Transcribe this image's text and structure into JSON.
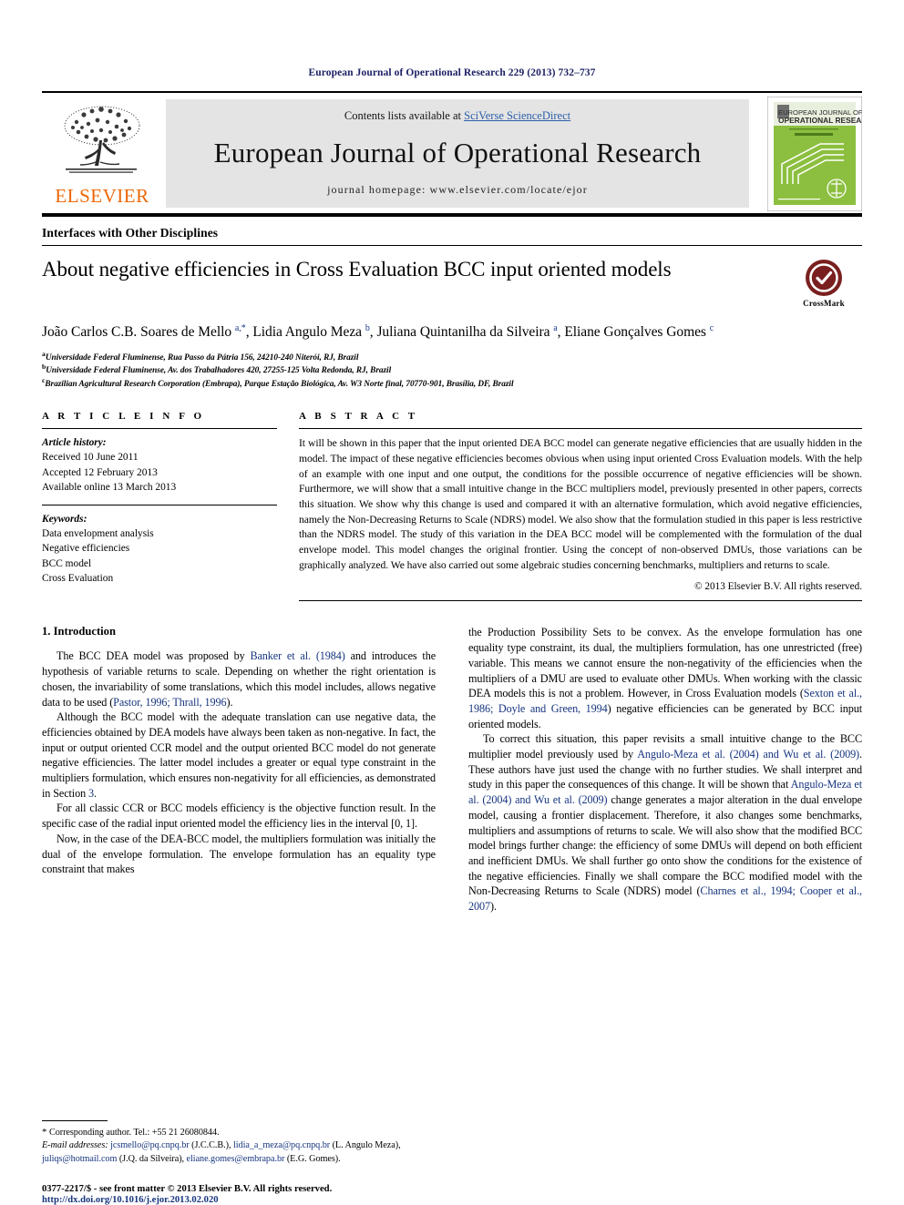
{
  "running_head": "European Journal of Operational Research 229 (2013) 732–737",
  "masthead": {
    "publisher_name": "ELSEVIER",
    "contents_prefix": "Contents lists available at ",
    "contents_link": "SciVerse ScienceDirect",
    "journal_name": "European Journal of Operational Research",
    "homepage": "journal homepage: www.elsevier.com/locate/ejor",
    "cover_title_line1": "EUROPEAN JOURNAL OF",
    "cover_title_line2": "OPERATIONAL RESEARCH"
  },
  "section_label": "Interfaces with Other Disciplines",
  "title": "About negative efficiencies in Cross Evaluation BCC input oriented models",
  "crossmark_label": "CrossMark",
  "authors_html": "João Carlos C.B. Soares de Mello <sup>a,*</sup>, Lidia Angulo Meza <sup>b</sup>, Juliana Quintanilha da Silveira <sup>a</sup>, Eliane Gonçalves Gomes <sup>c</sup>",
  "affiliations": [
    {
      "marker": "a",
      "text": "Universidade Federal Fluminense, Rua Passo da Pátria 156, 24210-240 Niterói, RJ, Brazil"
    },
    {
      "marker": "b",
      "text": "Universidade Federal Fluminense, Av. dos Trabalhadores 420, 27255-125 Volta Redonda, RJ, Brazil"
    },
    {
      "marker": "c",
      "text": "Brazilian Agricultural Research Corporation (Embrapa), Parque Estação Biológica, Av. W3 Norte final, 70770-901, Brasília, DF, Brazil"
    }
  ],
  "article_info": {
    "kicker": "A R T I C L E I N F O",
    "history_header": "Article history:",
    "history": [
      "Received 10 June 2011",
      "Accepted 12 February 2013",
      "Available online 13 March 2013"
    ],
    "keywords_header": "Keywords:",
    "keywords": [
      "Data envelopment analysis",
      "Negative efficiencies",
      "BCC model",
      "Cross Evaluation"
    ]
  },
  "abstract": {
    "kicker": "A B S T R A C T",
    "text": "It will be shown in this paper that the input oriented DEA BCC model can generate negative efficiencies that are usually hidden in the model. The impact of these negative efficiencies becomes obvious when using input oriented Cross Evaluation models. With the help of an example with one input and one output, the conditions for the possible occurrence of negative efficiencies will be shown. Furthermore, we will show that a small intuitive change in the BCC multipliers model, previously presented in other papers, corrects this situation. We show why this change is used and compared it with an alternative formulation, which avoid negative efficiencies, namely the Non-Decreasing Returns to Scale (NDRS) model. We also show that the formulation studied in this paper is less restrictive than the NDRS model. The study of this variation in the DEA BCC model will be complemented with the formulation of the dual envelope model. This model changes the original frontier. Using the concept of non-observed DMUs, those variations can be graphically analyzed. We have also carried out some algebraic studies concerning benchmarks, multipliers and returns to scale.",
    "copyright": "© 2013 Elsevier B.V. All rights reserved."
  },
  "intro": {
    "heading": "1. Introduction",
    "left_paragraphs_html": [
      "The BCC DEA model was proposed by <a class=\"ref\" href=\"#\">Banker et al. (1984)</a> and introduces the hypothesis of variable returns to scale. Depending on whether the right orientation is chosen, the invariability of some translations, which this model includes, allows negative data to be used (<a class=\"ref\" href=\"#\">Pastor, 1996; Thrall, 1996</a>).",
      "Although the BCC model with the adequate translation can use negative data, the efficiencies obtained by DEA models have always been taken as non-negative. In fact, the input or output oriented CCR model and the output oriented BCC model do not generate negative efficiencies. The latter model includes a greater or equal type constraint in the multipliers formulation, which ensures non-negativity for all efficiencies, as demonstrated in Section <a class=\"ref\" href=\"#\">3</a>.",
      "For all classic CCR or BCC models efficiency is the objective function result. In the specific case of the radial input oriented model the efficiency lies in the interval [0, 1].",
      "Now, in the case of the DEA-BCC model, the multipliers formulation was initially the dual of the envelope formulation. The envelope formulation has an equality type constraint that makes"
    ],
    "right_paragraphs_html": [
      "the Production Possibility Sets to be convex. As the envelope formulation has one equality type constraint, its dual, the multipliers formulation, has one unrestricted (free) variable. This means we cannot ensure the non-negativity of the efficiencies when the multipliers of a DMU are used to evaluate other DMUs. When working with the classic DEA models this is not a problem. However, in Cross Evaluation models (<a class=\"ref\" href=\"#\">Sexton et al., 1986; Doyle and Green, 1994</a>) negative efficiencies can be generated by BCC input oriented models.",
      "To correct this situation, this paper revisits a small intuitive change to the BCC multiplier model previously used by <a class=\"ref\" href=\"#\">Angulo-Meza et al. (2004) and Wu et al. (2009)</a>. These authors have just used the change with no further studies. We shall interpret and study in this paper the consequences of this change. It will be shown that <a class=\"ref\" href=\"#\">Angulo-Meza et al. (2004) and Wu et al. (2009)</a> change generates a major alteration in the dual envelope model, causing a frontier displacement. Therefore, it also changes some benchmarks, multipliers and assumptions of returns to scale. We will also show that the modified BCC model brings further change: the efficiency of some DMUs will depend on both efficient and inefficient DMUs. We shall further go onto show the conditions for the existence of the negative efficiencies. Finally we shall compare the BCC modified model with the Non-Decreasing Returns to Scale (NDRS) model (<a class=\"ref\" href=\"#\">Charnes et al., 1994; Cooper et al., 2007</a>)."
    ]
  },
  "footnotes": {
    "corresponding_html": "<span class=\"corr-star\">*</span> Corresponding author. Tel.: +55 21 26080844.",
    "emails_html": "<em>E-mail addresses:</em> <a href=\"#\">jcsmello@pq.cnpq.br</a> (J.C.C.B.), <a href=\"#\">lidia_a_meza@pq.cnpq.br</a> (L. Angulo Meza), <a href=\"#\">juliqs@hotmail.com</a> (J.Q. da Silveira), <a href=\"#\">eliane.gomes@embrapa.br</a> (E.G. Gomes)."
  },
  "imprint": {
    "line1": "0377-2217/$ - see front matter © 2013 Elsevier B.V. All rights reserved.",
    "line2": "http://dx.doi.org/10.1016/j.ejor.2013.02.020"
  },
  "colors": {
    "running_head": "#1b1f63",
    "link": "#16357f",
    "elsevier_orange": "#ec6707",
    "masthead_bg": "#e4e4e4",
    "cover_green": "#8cbf3f"
  }
}
